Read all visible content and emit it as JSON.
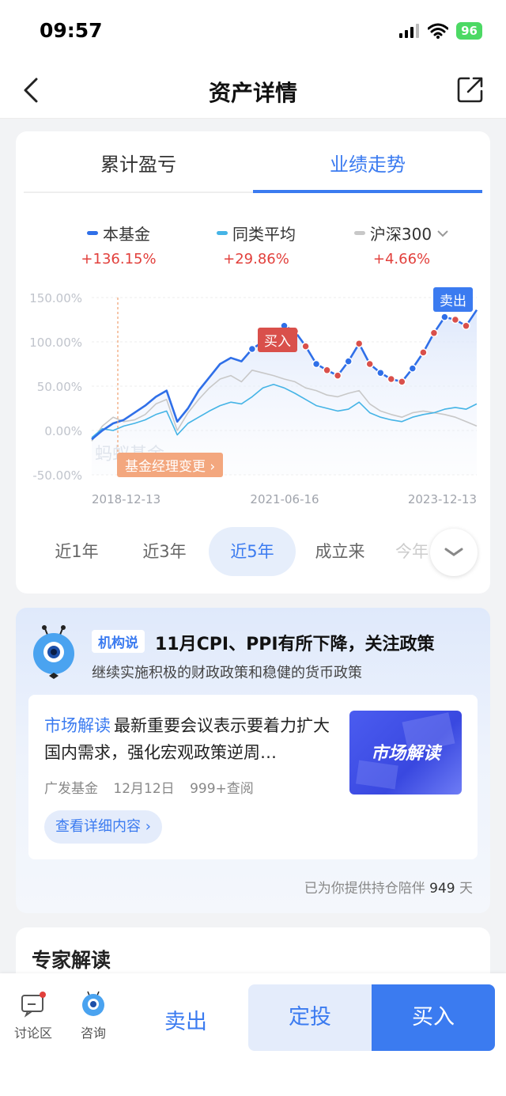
{
  "status": {
    "time": "09:57",
    "battery": "96"
  },
  "nav": {
    "title": "资产详情"
  },
  "tabs": [
    {
      "label": "累计盈亏"
    },
    {
      "label": "业绩走势"
    }
  ],
  "legend": [
    {
      "name": "本基金",
      "value": "+136.15%",
      "color": "#2f6fe8"
    },
    {
      "name": "同类平均",
      "value": "+29.86%",
      "color": "#45b4e6"
    },
    {
      "name": "沪深300",
      "value": "+4.66%",
      "color": "#c8c8c8"
    }
  ],
  "chart_data": {
    "type": "line",
    "ylim": [
      -50,
      150
    ],
    "yticks": [
      "150.00%",
      "100.00%",
      "50.00%",
      "0.00%",
      "-50.00%"
    ],
    "xticks": [
      "2018-12-13",
      "2021-06-16",
      "2023-12-13"
    ],
    "series": [
      {
        "name": "本基金",
        "values": [
          -10,
          0,
          8,
          12,
          20,
          28,
          38,
          45,
          10,
          25,
          45,
          60,
          75,
          82,
          78,
          92,
          100,
          110,
          118,
          112,
          95,
          75,
          68,
          62,
          78,
          98,
          75,
          65,
          58,
          55,
          70,
          88,
          110,
          128,
          125,
          118,
          136
        ]
      },
      {
        "name": "同类平均",
        "values": [
          -8,
          2,
          0,
          5,
          8,
          12,
          18,
          22,
          -5,
          8,
          15,
          22,
          28,
          32,
          30,
          38,
          48,
          52,
          48,
          42,
          35,
          28,
          25,
          22,
          24,
          32,
          20,
          15,
          12,
          10,
          15,
          18,
          20,
          24,
          26,
          24,
          30
        ]
      },
      {
        "name": "沪深300",
        "values": [
          -12,
          5,
          15,
          10,
          12,
          18,
          30,
          35,
          0,
          20,
          35,
          48,
          58,
          62,
          55,
          68,
          65,
          62,
          58,
          55,
          48,
          45,
          40,
          38,
          42,
          45,
          30,
          22,
          18,
          15,
          20,
          22,
          20,
          18,
          15,
          10,
          5
        ]
      }
    ],
    "annotations": [
      "买入",
      "卖出",
      "基金经理变更"
    ]
  },
  "periods": [
    "近1年",
    "近3年",
    "近5年",
    "成立来",
    "今年"
  ],
  "news": {
    "badge": "机构说",
    "headline": "11月CPI、PPI有所下降，关注政策",
    "sub": "继续实施积极的财政政策和稳健的货币政策",
    "article": {
      "tag": "市场解读",
      "title": "最新重要会议表示要着力扩大国内需求，强化宏观政策逆周…",
      "source": "广发基金",
      "date": "12月12日",
      "views": "999+查阅",
      "link": "查看详细内容",
      "thumb_label": "市场解读"
    },
    "footer_prefix": "已为你提供持仓陪伴",
    "footer_days": "949",
    "footer_suffix": "天"
  },
  "expert": {
    "title": "专家解读"
  },
  "bottom": {
    "discuss": "讨论区",
    "consult": "咨询",
    "sell": "卖出",
    "plan": "定投",
    "buy": "买入"
  },
  "watermark": "蚂蚁基金"
}
